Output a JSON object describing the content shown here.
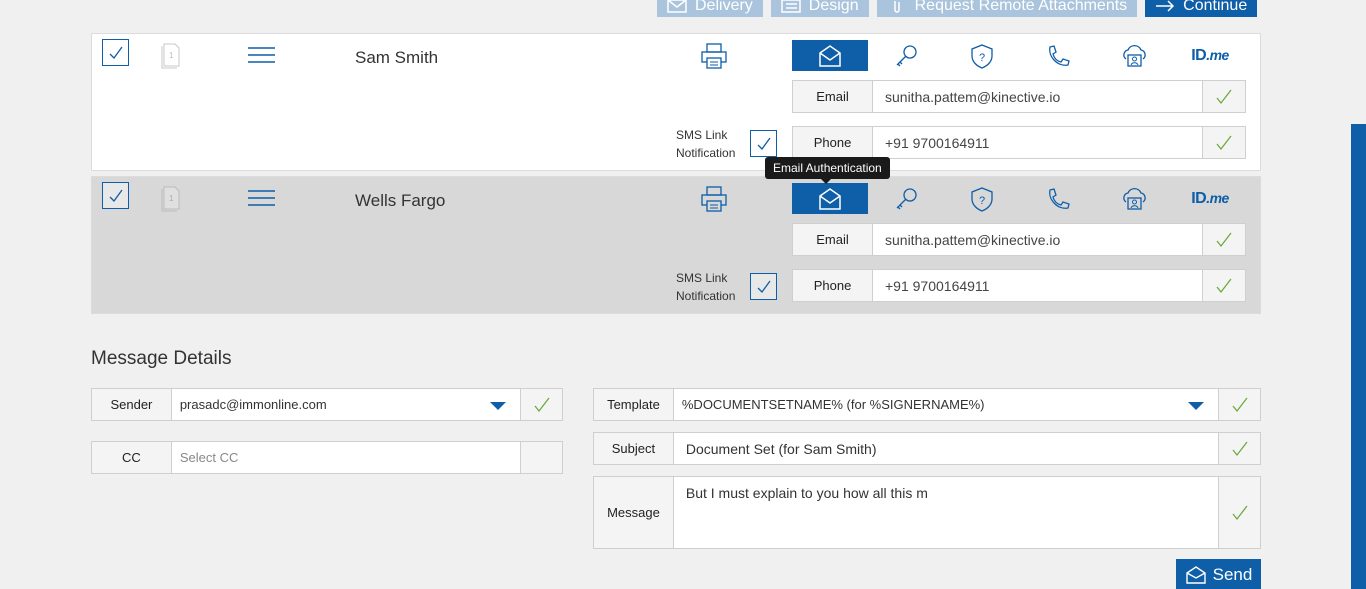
{
  "toolbar": {
    "delivery": "Delivery",
    "design": "Design",
    "request_remote": "Request Remote Attachments",
    "continue": "Continue"
  },
  "recipients": [
    {
      "name": "Sam Smith",
      "sms_label_1": "SMS Link",
      "sms_label_2": "Notification",
      "email_label": "Email",
      "email": "sunitha.pattem@kinective.io",
      "phone_label": "Phone",
      "phone": "+91 9700164911",
      "idme_main": "ID",
      "idme_suffix": ".me"
    },
    {
      "name": "Wells Fargo",
      "sms_label_1": "SMS Link",
      "sms_label_2": "Notification",
      "email_label": "Email",
      "email": "sunitha.pattem@kinective.io",
      "phone_label": "Phone",
      "phone": "+91 9700164911",
      "idme_main": "ID",
      "idme_suffix": ".me"
    }
  ],
  "tooltip": "Email Authentication",
  "message_details": {
    "title": "Message Details",
    "sender_label": "Sender",
    "sender_value": "prasadc@immonline.com",
    "cc_label": "CC",
    "cc_placeholder": "Select CC",
    "template_label": "Template",
    "template_value": "%DOCUMENTSETNAME% (for %SIGNERNAME%)",
    "subject_label": "Subject",
    "subject_value": "Document Set (for Sam Smith)",
    "message_label": "Message",
    "message_value": "But I must explain to you how all this m",
    "send_label": "Send"
  },
  "colors": {
    "accent": "#0e5ea8",
    "accent_light": "#a9c4dc",
    "ok_green": "#6aab3c"
  }
}
